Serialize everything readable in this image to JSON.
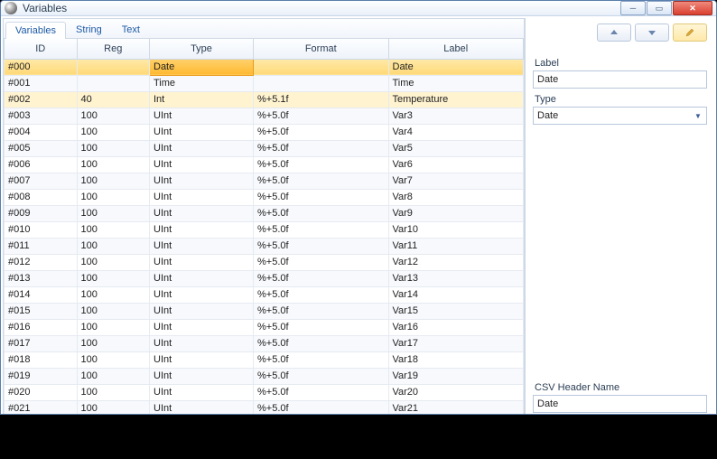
{
  "title": "Variables",
  "tabs": [
    "Variables",
    "String",
    "Text"
  ],
  "active_tab": 0,
  "columns": [
    "ID",
    "Reg",
    "Type",
    "Format",
    "Label"
  ],
  "rows": [
    {
      "id": "#000",
      "reg": "",
      "type": "Date",
      "format": "",
      "label": "Date",
      "selected": true
    },
    {
      "id": "#001",
      "reg": "",
      "type": "Time",
      "format": "",
      "label": "Time"
    },
    {
      "id": "#002",
      "reg": "40",
      "type": "Int",
      "format": "%+5.1f",
      "label": "Temperature",
      "hl": true
    },
    {
      "id": "#003",
      "reg": "100",
      "type": "UInt",
      "format": "%+5.0f",
      "label": "Var3"
    },
    {
      "id": "#004",
      "reg": "100",
      "type": "UInt",
      "format": "%+5.0f",
      "label": "Var4"
    },
    {
      "id": "#005",
      "reg": "100",
      "type": "UInt",
      "format": "%+5.0f",
      "label": "Var5"
    },
    {
      "id": "#006",
      "reg": "100",
      "type": "UInt",
      "format": "%+5.0f",
      "label": "Var6"
    },
    {
      "id": "#007",
      "reg": "100",
      "type": "UInt",
      "format": "%+5.0f",
      "label": "Var7"
    },
    {
      "id": "#008",
      "reg": "100",
      "type": "UInt",
      "format": "%+5.0f",
      "label": "Var8"
    },
    {
      "id": "#009",
      "reg": "100",
      "type": "UInt",
      "format": "%+5.0f",
      "label": "Var9"
    },
    {
      "id": "#010",
      "reg": "100",
      "type": "UInt",
      "format": "%+5.0f",
      "label": "Var10"
    },
    {
      "id": "#011",
      "reg": "100",
      "type": "UInt",
      "format": "%+5.0f",
      "label": "Var11"
    },
    {
      "id": "#012",
      "reg": "100",
      "type": "UInt",
      "format": "%+5.0f",
      "label": "Var12"
    },
    {
      "id": "#013",
      "reg": "100",
      "type": "UInt",
      "format": "%+5.0f",
      "label": "Var13"
    },
    {
      "id": "#014",
      "reg": "100",
      "type": "UInt",
      "format": "%+5.0f",
      "label": "Var14"
    },
    {
      "id": "#015",
      "reg": "100",
      "type": "UInt",
      "format": "%+5.0f",
      "label": "Var15"
    },
    {
      "id": "#016",
      "reg": "100",
      "type": "UInt",
      "format": "%+5.0f",
      "label": "Var16"
    },
    {
      "id": "#017",
      "reg": "100",
      "type": "UInt",
      "format": "%+5.0f",
      "label": "Var17"
    },
    {
      "id": "#018",
      "reg": "100",
      "type": "UInt",
      "format": "%+5.0f",
      "label": "Var18"
    },
    {
      "id": "#019",
      "reg": "100",
      "type": "UInt",
      "format": "%+5.0f",
      "label": "Var19"
    },
    {
      "id": "#020",
      "reg": "100",
      "type": "UInt",
      "format": "%+5.0f",
      "label": "Var20"
    },
    {
      "id": "#021",
      "reg": "100",
      "type": "UInt",
      "format": "%+5.0f",
      "label": "Var21"
    }
  ],
  "panel": {
    "label_caption": "Label",
    "label_value": "Date",
    "type_caption": "Type",
    "type_value": "Date",
    "csv_caption": "CSV Header Name",
    "csv_value": "Date"
  }
}
